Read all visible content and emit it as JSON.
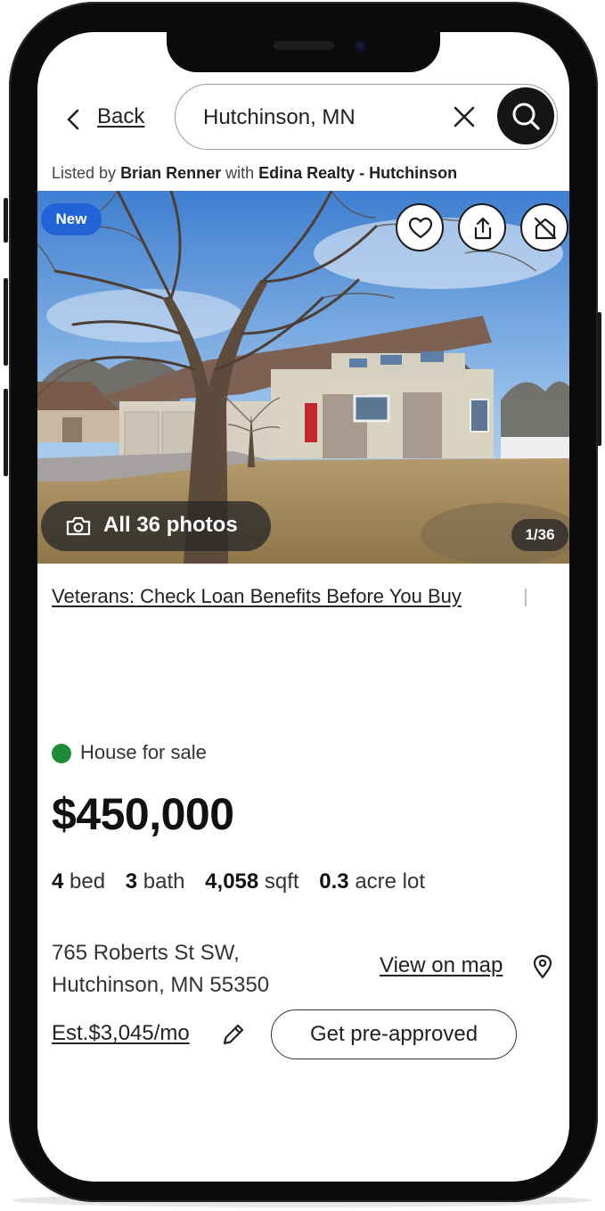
{
  "header": {
    "back_label": "Back",
    "search_value": "Hutchinson, MN"
  },
  "listing_credit": {
    "prefix": "Listed by",
    "agent": "Brian Renner",
    "mid": "with",
    "brokerage": "Edina Realty - Hutchinson"
  },
  "photo": {
    "badge": "New",
    "all_photos_label": "All 36 photos",
    "counter": "1/36",
    "icons": [
      "heart-icon",
      "share-icon",
      "hide-home-icon",
      "camera-icon"
    ]
  },
  "promo": {
    "veterans_link": "Veterans: Check Loan Benefits Before You Buy"
  },
  "listing": {
    "status": "House for sale",
    "status_color": "#1d8a35",
    "price": "$450,000",
    "beds_value": "4",
    "beds_unit": "bed",
    "baths_value": "3",
    "baths_unit": "bath",
    "sqft_value": "4,058",
    "sqft_unit": "sqft",
    "lot_value": "0.3",
    "lot_unit": "acre lot",
    "address_line1": "765 Roberts St SW,",
    "address_line2": "Hutchinson, MN 55350",
    "map_link": "View on map",
    "estimate": "Est.$3,045/mo",
    "preapproved_button": "Get pre-approved"
  },
  "colors": {
    "new_badge": "#1f63d6",
    "search_button": "#151515"
  }
}
